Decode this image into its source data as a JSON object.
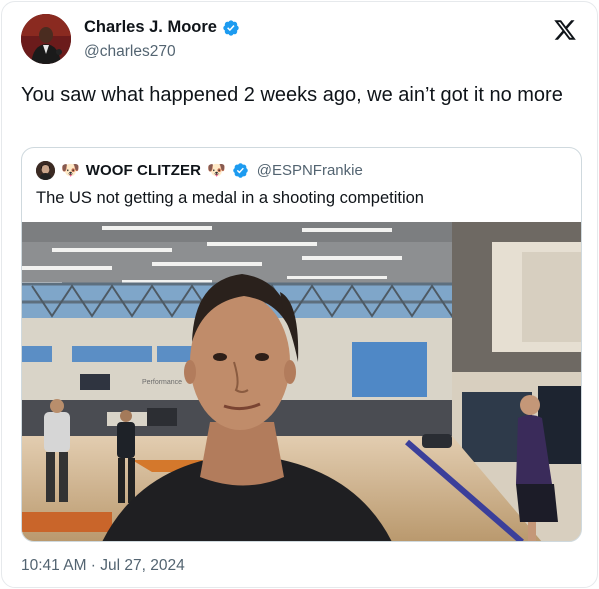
{
  "author": {
    "display_name": "Charles J. Moore",
    "handle": "@charles270",
    "verified": true,
    "avatar_icon": "user-avatar"
  },
  "tweet": {
    "text": "You saw what happened 2 weeks ago, we ain’t got it no more",
    "timestamp": "10:41 AM · Jul 27, 2024"
  },
  "quoted_tweet": {
    "display_name": "WOOF CLITZER",
    "name_emoji": "🐶",
    "handle": "@ESPNFrankie",
    "verified": true,
    "text": "The US not getting a medal in a shooting competition",
    "media_type": "photo"
  },
  "colors": {
    "verified_blue": "#1d9bf0",
    "secondary_text": "#536471",
    "border": "#cfd9de"
  },
  "icons": {
    "brand": "x-logo-icon",
    "verified": "verified-badge-icon"
  }
}
